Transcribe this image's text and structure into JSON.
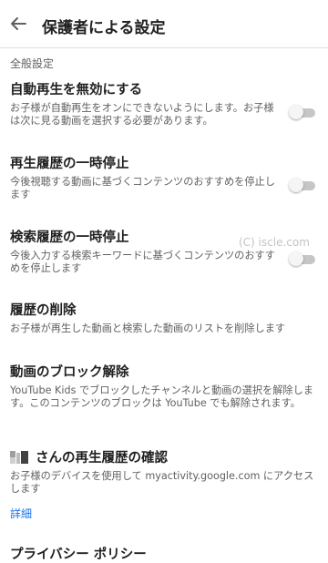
{
  "header": {
    "title": "保護者による設定"
  },
  "section": {
    "label": "全般設定"
  },
  "items": [
    {
      "title": "自動再生を無効にする",
      "description": "お子様が自動再生をオンにできないようにします。お子様は次に見る動画を選択する必要があります。",
      "toggle_on": false
    },
    {
      "title": "再生履歴の一時停止",
      "description": "今後視聴する動画に基づくコンテンツのおすすめを停止します",
      "toggle_on": false
    },
    {
      "title": "検索履歴の一時停止",
      "description": "今後入力する検索キーワードに基づくコンテンツのおすすめを停止します",
      "toggle_on": false
    },
    {
      "title": "履歴の削除",
      "description": "お子様が再生した動画と検索した動画のリストを削除します"
    },
    {
      "title": "動画のブロック解除",
      "description": "YouTube Kids でブロックしたチャンネルと動画の選択を解除します。このコンテンツのブロックは YouTube でも解除されます。"
    },
    {
      "title": "さんの再生履歴の確認",
      "description": "お子様のデバイスを使用して myactivity.google.com にアクセスします"
    },
    {
      "title": "プライバシー ポリシー"
    }
  ],
  "link": {
    "label": "詳細"
  },
  "watermark": "(C) iscle.com",
  "colors": {
    "link": "#1a73e8",
    "toggle_track_off": "#c6c6c6",
    "toggle_thumb_off": "#f5f5f5"
  },
  "icons": {
    "back": "arrow-back-icon"
  }
}
